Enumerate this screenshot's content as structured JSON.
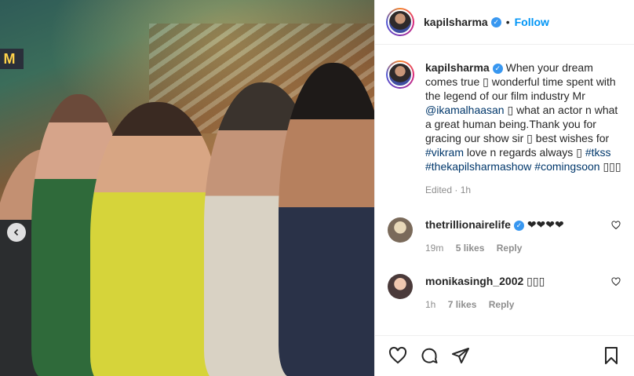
{
  "post": {
    "username": "kapilsharma",
    "follow_label": "Follow",
    "dot": "•",
    "verified_glyph": "✓"
  },
  "caption": {
    "username": "kapilsharma",
    "text_1": " When your dream comes true ",
    "placeholder_glyph": "▯",
    "text_2": " wonderful time spent with the legend of our film industry Mr ",
    "mention": "@ikamalhaasan",
    "text_3": " what an actor n what a great human being.Thank you for gracing our show sir ",
    "text_4": " best wishes for ",
    "tag_vikram": "#vikram",
    "text_5": " love n regards always ",
    "tag_tkss": "#tkss",
    "tag_show": "#thekapilsharmashow",
    "tag_coming": "#comingsoon",
    "trailing_glyphs": "▯▯▯",
    "meta": "Edited · 1h"
  },
  "comments": [
    {
      "username": "thetrillionairelife",
      "text": "❤❤❤❤",
      "time": "19m",
      "likes": "5 likes",
      "reply": "Reply"
    },
    {
      "username": "monikasingh_2002",
      "text": "▯▯▯",
      "time": "1h",
      "likes": "7 likes",
      "reply": "Reply"
    }
  ],
  "photo": {
    "sign_text": "M"
  },
  "colors": {
    "link": "#00376b",
    "follow": "#0095f6",
    "verified": "#3897f0",
    "muted": "#8e8e8e"
  },
  "icons": [
    "heart-icon",
    "comment-icon",
    "share-icon",
    "bookmark-icon",
    "chevron-left-icon",
    "verified-icon"
  ]
}
